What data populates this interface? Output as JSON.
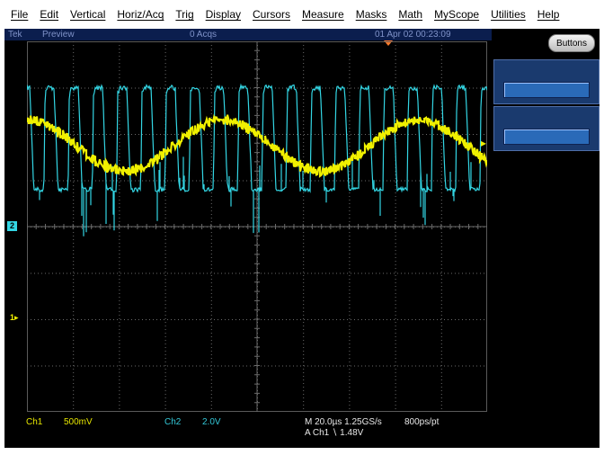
{
  "menu": {
    "items": [
      "File",
      "Edit",
      "Vertical",
      "Horiz/Acq",
      "Trig",
      "Display",
      "Cursors",
      "Measure",
      "Masks",
      "Math",
      "MyScope",
      "Utilities",
      "Help"
    ]
  },
  "status": {
    "brand": "Tek",
    "mode": "Preview",
    "acqs": "0 Acqs",
    "datetime": "01 Apr 02 00:23:09"
  },
  "side_panel": {
    "buttons_label": "Buttons"
  },
  "markers": {
    "ch2": "2",
    "ch1": "1"
  },
  "readout": {
    "ch1_label": "Ch1",
    "ch1_scale": "500mV",
    "ch2_label": "Ch2",
    "ch2_scale": "2.0V",
    "timebase": "M 20.0µs 1.25GS/s",
    "resolution": "800ps/pt",
    "trigger": "A  Ch1  ∖  1.48V"
  },
  "colors": {
    "ch1": "#f0f000",
    "ch2": "#33d6e4",
    "status_bg": "#0b1e4e",
    "trigger_marker": "#ff7a2a"
  },
  "waveforms": {
    "ch1": {
      "shape": "sine",
      "cycles": 2.35,
      "amplitude_divisions": 0.55,
      "center_division": 2.25
    },
    "ch2": {
      "shape": "square-spiky",
      "pulses": 19,
      "high_division": 1.0,
      "low_division": 3.2
    }
  }
}
